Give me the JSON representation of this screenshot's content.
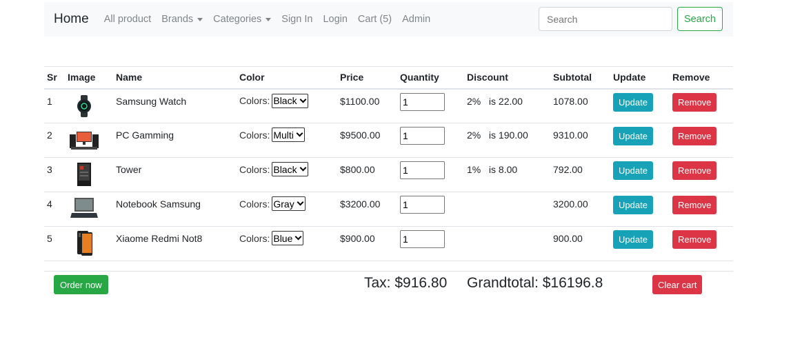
{
  "navbar": {
    "brand": "Home",
    "items": [
      {
        "label": "All product",
        "dropdown": false
      },
      {
        "label": "Brands",
        "dropdown": true
      },
      {
        "label": "Categories",
        "dropdown": true
      },
      {
        "label": "Sign In",
        "dropdown": false
      },
      {
        "label": "Login",
        "dropdown": false
      },
      {
        "label": "Cart (5)",
        "dropdown": false
      },
      {
        "label": "Admin",
        "dropdown": false
      }
    ],
    "search_placeholder": "Search",
    "search_button": "Search"
  },
  "table": {
    "headers": [
      "Sr",
      "Image",
      "Name",
      "Color",
      "Price",
      "Quantity",
      "Discount",
      "Subtotal",
      "Update",
      "Remove"
    ],
    "color_label": "Colors:",
    "update_label": "Update",
    "remove_label": "Remove",
    "rows": [
      {
        "sr": "1",
        "image": "smartwatch-thumbnail",
        "name": "Samsung Watch",
        "color": "Black",
        "price": "$1100.00",
        "quantity": "1",
        "discount_pct": "2%",
        "discount_amt": "is 22.00",
        "subtotal": "1078.00"
      },
      {
        "sr": "2",
        "image": "gaming-pc-thumbnail",
        "name": "PC Gamming",
        "color": "Multi",
        "price": "$9500.00",
        "quantity": "1",
        "discount_pct": "2%",
        "discount_amt": "is 190.00",
        "subtotal": "9310.00"
      },
      {
        "sr": "3",
        "image": "pc-tower-thumbnail",
        "name": "Tower",
        "color": "Black",
        "price": "$800.00",
        "quantity": "1",
        "discount_pct": "1%",
        "discount_amt": "is 8.00",
        "subtotal": "792.00"
      },
      {
        "sr": "4",
        "image": "laptop-thumbnail",
        "name": "Notebook Samsung",
        "color": "Gray",
        "price": "$3200.00",
        "quantity": "1",
        "discount_pct": "",
        "discount_amt": "",
        "subtotal": "3200.00"
      },
      {
        "sr": "5",
        "image": "phone-thumbnail",
        "name": "Xiaome Redmi Not8",
        "color": "Blue",
        "price": "$900.00",
        "quantity": "1",
        "discount_pct": "",
        "discount_amt": "",
        "subtotal": "900.00"
      }
    ]
  },
  "footer": {
    "order_button": "Order now",
    "tax": "Tax: $916.80",
    "grandtotal": "Grandtotal: $16196.8",
    "clear_button": "Clear cart"
  },
  "colors": {
    "success": "#28a745",
    "info": "#17a2b8",
    "danger": "#dc3545",
    "navbar_bg": "#f8f9fa"
  }
}
